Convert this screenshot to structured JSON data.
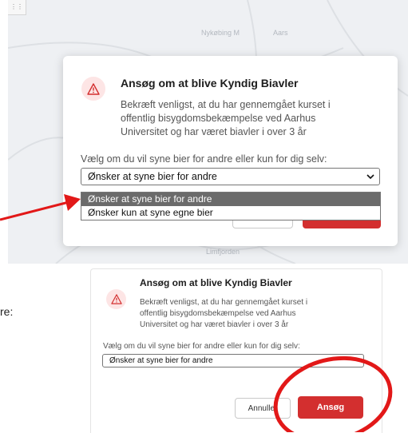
{
  "map": {
    "corner": "⋮⋮",
    "labels": [
      "Nykøbing M",
      "Aars",
      "Limfjorden"
    ]
  },
  "dialog_top": {
    "title": "Ansøg om at blive Kyndig Biavler",
    "body": [
      "Bekræft venligst, at du har gennemgået kurset i",
      "offentlig bisygdomsbekæmpelse ved Aarhus",
      "Universitet og har været biavler i over 3 år"
    ],
    "prompt": "Vælg om du vil syne bier for andre eller kun for dig selv:",
    "select_value": "Ønsker at syne bier for andre",
    "options": [
      "Ønsker at syne bier for andre",
      "Ønsker kun at syne egne bier"
    ]
  },
  "dialog_bottom": {
    "title": "Ansøg om at blive Kyndig Biavler",
    "body": [
      "Bekræft venligst, at du har gennemgået kurset i",
      "offentlig bisygdomsbekæmpelse ved Aarhus",
      "Universitet og har været biavler i over 3 år"
    ],
    "prompt": "Vælg om du vil syne bier for andre eller kun for dig selv:",
    "select_value": "Ønsker at syne bier for andre",
    "cancel_label": "Annuller",
    "submit_label": "Ansøg"
  },
  "side_text": "re:",
  "colors": {
    "accent": "#d32f2f",
    "annotation": "#e21818",
    "selected_option": "#6b6b6b"
  },
  "icons": {
    "warning": "warning-triangle-icon",
    "chevron": "chevron-down-icon"
  }
}
